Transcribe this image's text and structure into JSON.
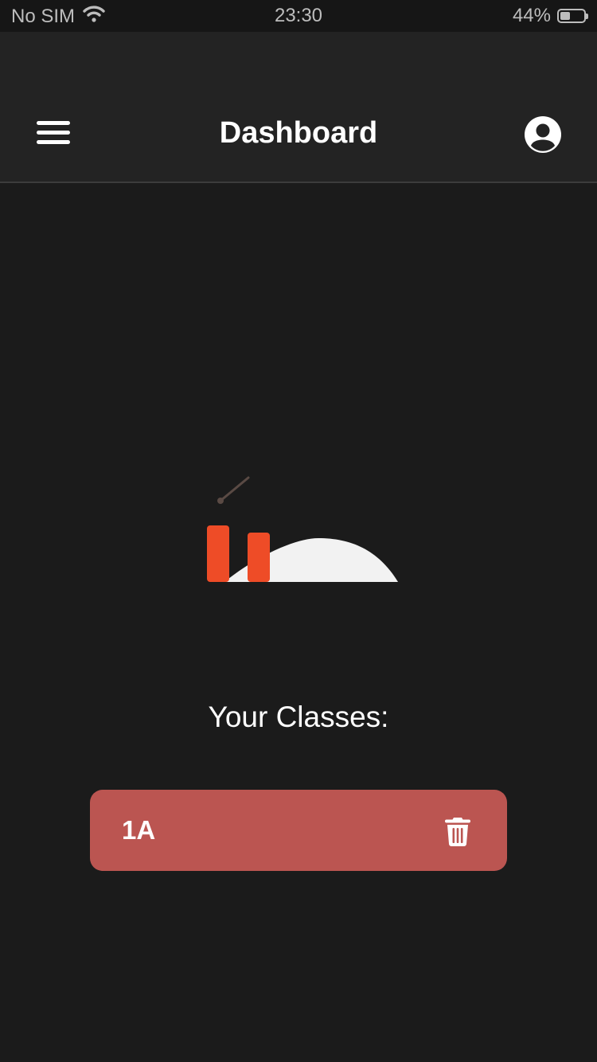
{
  "status_bar": {
    "carrier": "No SIM",
    "time": "23:30",
    "battery": "44%",
    "battery_level": 0.44,
    "wifi_icon": "wifi-icon"
  },
  "header": {
    "title": "Dashboard",
    "menu_icon": "hamburger-menu-icon",
    "profile_icon": "user-circle-icon"
  },
  "main": {
    "section_title": "Your Classes:",
    "classes": [
      {
        "name": "1A",
        "action_icon": "trash-icon"
      }
    ]
  },
  "colors": {
    "background": "#1b1b1b",
    "header": "#232323",
    "class_card": "#bb5551",
    "illustration_accent": "#ee4c27"
  }
}
